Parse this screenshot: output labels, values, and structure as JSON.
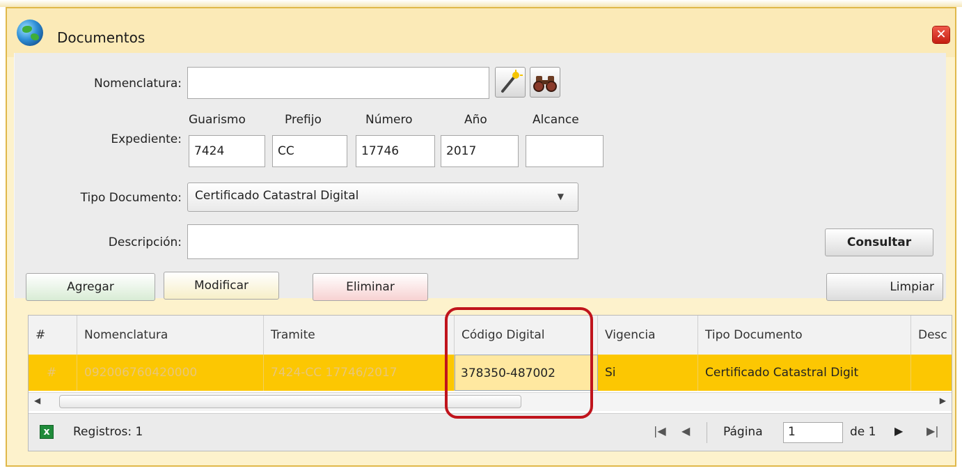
{
  "window": {
    "title": "Documentos",
    "close_icon": "close-icon",
    "app_icon": "globe-icon"
  },
  "form": {
    "nomenclatura_label": "Nomenclatura:",
    "nomenclatura_value": "",
    "expediente_label": "Expediente:",
    "expediente_cols": [
      "Guarismo",
      "Prefijo",
      "Número",
      "Año",
      "Alcance"
    ],
    "guarismo": "7424",
    "prefijo": "CC",
    "numero": "17746",
    "anio": "2017",
    "alcance": "",
    "tipo_label": "Tipo Documento:",
    "tipo_value": "Certificado Catastral Digital",
    "descripcion_label": "Descripción:",
    "descripcion_value": ""
  },
  "buttons": {
    "consultar": "Consultar",
    "agregar": "Agregar",
    "modificar": "Modificar",
    "eliminar": "Eliminar",
    "limpiar": "Limpiar"
  },
  "grid": {
    "columns": [
      "#",
      "Nomenclatura",
      "Tramite",
      "Código Digital",
      "Vigencia",
      "Tipo Documento",
      "Desc"
    ],
    "rows": [
      [
        "#",
        "092006760420000",
        "7424-CC 17746/2017",
        "378350-487002",
        "Si",
        "Certificado Catastral Digit",
        ""
      ]
    ],
    "highlight_color": "#fcc702"
  },
  "footer": {
    "registros": "Registros: 1",
    "pagina_label": "Página",
    "pagina_value": "1",
    "de_label": "de 1"
  },
  "annotation_color": "#c0141c"
}
